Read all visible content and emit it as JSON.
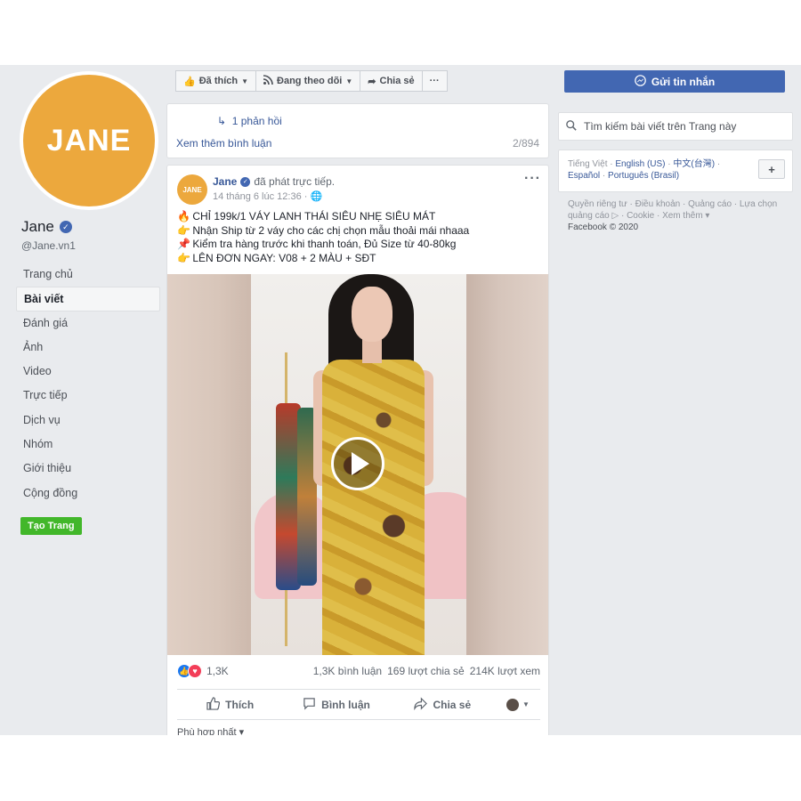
{
  "sidebar": {
    "avatar_text": "JANE",
    "page_name": "Jane",
    "handle": "@Jane.vn1",
    "nav": [
      "Trang chủ",
      "Bài viết",
      "Đánh giá",
      "Ảnh",
      "Video",
      "Trực tiếp",
      "Dịch vụ",
      "Nhóm",
      "Giới thiệu",
      "Cộng đồng"
    ],
    "active_index": 1,
    "create_page": "Tạo Trang"
  },
  "toolbar": {
    "like": "Đã thích",
    "follow": "Đang theo dõi",
    "share": "Chia sẻ",
    "more": "···"
  },
  "comments": {
    "reply": "1 phản hồi",
    "more": "Xem thêm bình luận",
    "count": "2/894"
  },
  "post": {
    "avatar_text": "JANE",
    "author": "Jane",
    "action": "đã phát trực tiếp.",
    "time": "14 tháng 6 lúc 12:36 ·",
    "menu": "···",
    "lines": [
      {
        "emoji": "🔥",
        "text": "CHỈ 199k/1 VÁY LANH THÁI SIÊU NHẸ SIÊU MÁT"
      },
      {
        "emoji": "👉",
        "text": "Nhận Ship từ 2 váy cho các chị chọn mẫu thoải mái nhaaa"
      },
      {
        "emoji": "📌",
        "text": "Kiểm tra hàng trước khi thanh toán, Đủ Size từ 40-80kg"
      },
      {
        "emoji": "👉",
        "text": "LÊN ĐƠN NGAY: V08 + 2 MÀU + SĐT"
      }
    ],
    "reaction_count": "1,3K",
    "comment_count": "1,3K bình luận",
    "share_count": "169 lượt chia sẻ",
    "view_count": "214K lượt xem",
    "actions": {
      "like": "Thích",
      "comment": "Bình luận",
      "share": "Chia sẻ"
    },
    "sort": "Phù hợp nhất ▾"
  },
  "right": {
    "message_button": "Gửi tin nhắn",
    "search_placeholder": "Tìm kiếm bài viết trên Trang này",
    "languages": {
      "current": "Tiếng Việt",
      "others": [
        "English (US)",
        "中文(台灣)",
        "Español",
        "Português (Brasil)"
      ]
    },
    "footer": "Quyền riêng tư · Điều khoản · Quảng cáo · Lựa chọn quảng cáo ▷ · Cookie · Xem thêm ▾",
    "copyright": "Facebook © 2020"
  },
  "icons": {
    "verified": "check-badge-icon",
    "like": "thumbs-up-icon",
    "love": "heart-icon",
    "rss": "rss-icon",
    "share": "share-arrow-icon",
    "search": "search-icon",
    "messenger": "messenger-icon",
    "play": "play-icon",
    "plus": "plus-icon"
  },
  "colors": {
    "brand": "#4267b2",
    "avatar": "#eca83d",
    "create_page": "#42b72a",
    "link": "#385898"
  }
}
